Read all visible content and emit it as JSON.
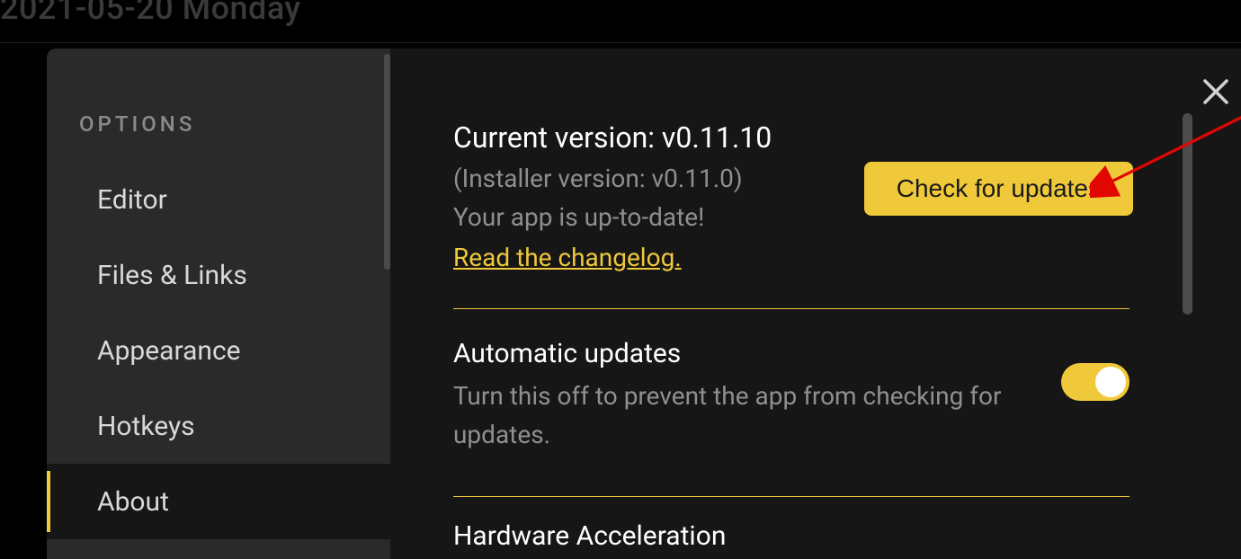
{
  "background": {
    "date_text": "2021-05-20 Monday"
  },
  "sidebar": {
    "heading": "OPTIONS",
    "items": [
      {
        "label": "Editor",
        "active": false
      },
      {
        "label": "Files & Links",
        "active": false
      },
      {
        "label": "Appearance",
        "active": false
      },
      {
        "label": "Hotkeys",
        "active": false
      },
      {
        "label": "About",
        "active": true
      }
    ]
  },
  "about": {
    "current_version_label": "Current version: v0.11.10",
    "installer_version_label": "(Installer version: v0.11.0)",
    "uptodate_text": "Your app is up-to-date!",
    "changelog_link": "Read the changelog.",
    "check_button": "Check for updates",
    "auto_updates": {
      "title": "Automatic updates",
      "description": "Turn this off to prevent the app from checking for updates.",
      "enabled": true
    },
    "hardware_accel": {
      "title": "Hardware Acceleration"
    }
  },
  "colors": {
    "accent": "#f0c93a",
    "bg_modal": "#161616",
    "bg_sidebar": "#2a2a2a",
    "text_muted": "#8f8f8f"
  }
}
